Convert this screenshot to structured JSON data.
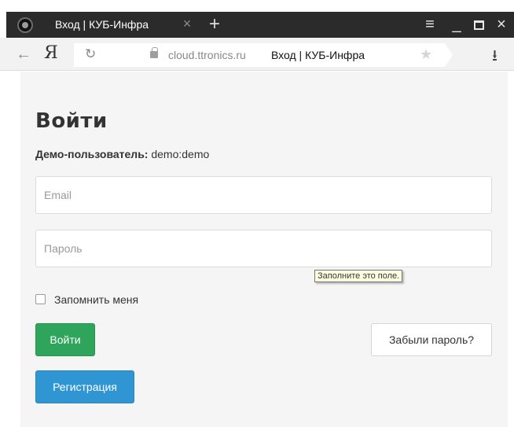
{
  "browser": {
    "tab_title": "Вход | КУБ-Инфра",
    "tab_close": "×",
    "new_tab": "+",
    "menu_glyph": "≡",
    "minimize_glyph": "_",
    "close_glyph": "×",
    "back_glyph": "←",
    "logo": "Я",
    "reload_glyph": "↻",
    "url_domain": "cloud.ttronics.ru",
    "url_title": "Вход | КУБ-Инфра",
    "star_glyph": "★",
    "download_glyph": "⭳",
    "icons": [
      "favicon-icon",
      "menu-icon",
      "minimize-icon",
      "maximize-icon",
      "close-icon",
      "back-icon",
      "reload-icon",
      "lock-icon",
      "star-icon",
      "download-icon"
    ]
  },
  "page": {
    "title": "Войти",
    "demo_label": "Демо-пользователь:",
    "demo_value": " demo:demo",
    "email_placeholder": "Email",
    "password_placeholder": "Пароль",
    "tooltip": "Заполните это поле.",
    "remember_label": "Запомнить меня",
    "login_button": "Войти",
    "forgot_button": "Забыли пароль?",
    "register_button": "Регистрация"
  },
  "colors": {
    "login_button": "#2ea55b",
    "register_button": "#3096d3",
    "tab_bar": "#2b2b2b"
  }
}
